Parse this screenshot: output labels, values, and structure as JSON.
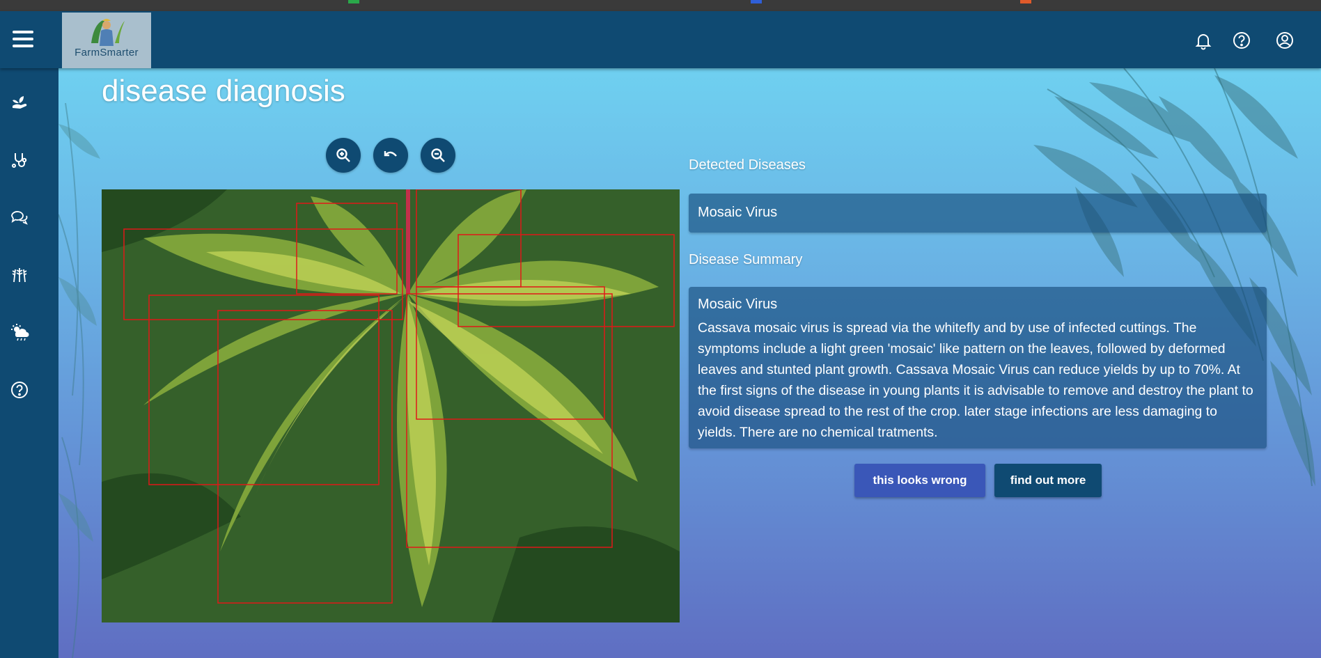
{
  "app": {
    "brand_text": "FarmSmarter"
  },
  "header": {
    "icons": [
      "bell-icon",
      "help-circle-icon",
      "account-circle-icon"
    ]
  },
  "sidebar": {
    "items": [
      {
        "icon": "plant-hand-icon"
      },
      {
        "icon": "stethoscope-icon"
      },
      {
        "icon": "chat-bubbles-icon"
      },
      {
        "icon": "wheat-icon"
      },
      {
        "icon": "weather-sun-rain-icon"
      },
      {
        "icon": "help-circle-icon"
      }
    ]
  },
  "page": {
    "title": "disease diagnosis"
  },
  "viewer": {
    "controls": [
      "zoom-in-icon",
      "undo-icon",
      "zoom-out-icon"
    ],
    "box_color": "#e01818"
  },
  "detected": {
    "label": "Detected Diseases",
    "disease": "Mosaic Virus"
  },
  "summary": {
    "label": "Disease Summary",
    "title": "Mosaic Virus",
    "text": "Cassava mosaic virus is spread via the whitefly and by use of infected cuttings. The symptoms include a light green 'mosaic' like pattern on the leaves, followed by deformed leaves and stunted plant growth. Cassava Mosaic Virus can reduce yields by up to 70%. At the first signs of the disease in young plants it is advisable to remove and destroy the plant to avoid disease spread to the rest of the crop. later stage infections are less damaging to yields. There are no chemical tratments."
  },
  "actions": {
    "wrong_label": "this looks wrong",
    "more_label": "find out more"
  },
  "colors": {
    "nav": "#0f4a72",
    "accent_button": "#3a57b8",
    "panel": "rgba(20,72,120,.62)"
  }
}
